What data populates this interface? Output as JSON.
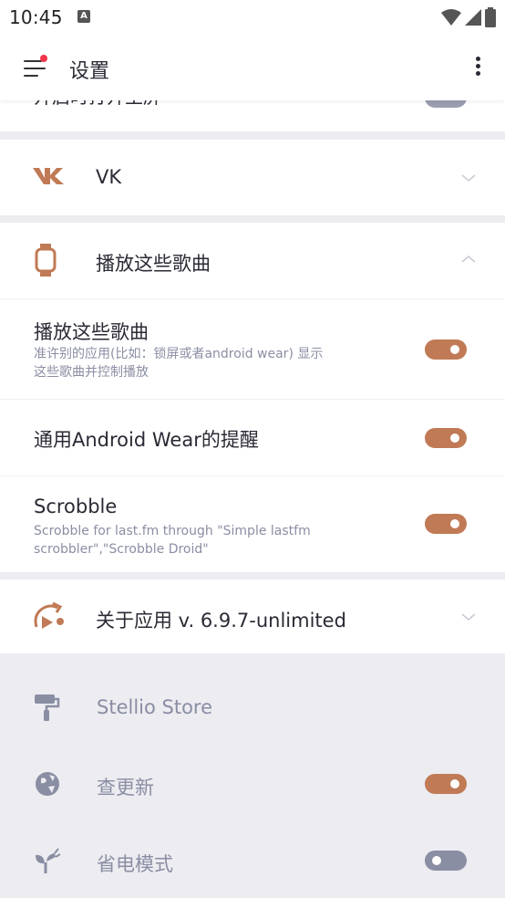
{
  "status_bar": {
    "time": "10:45",
    "notification_icon": "a-letter-icon"
  },
  "app_bar": {
    "title": "设置",
    "menu_icon": "menu-icon",
    "more_icon": "more-vertical-icon"
  },
  "cut_row": {
    "label": "开启时打开主屏"
  },
  "sections": {
    "vk": {
      "label": "VK",
      "icon": "vk-logo-icon",
      "expanded": false
    },
    "play_songs": {
      "label": "播放这些歌曲",
      "icon": "watch-icon",
      "expanded": true
    },
    "about": {
      "label": "关于应用 v. 6.9.7-unlimited",
      "icon": "about-app-icon",
      "expanded": false
    }
  },
  "settings": [
    {
      "title": "播放这些歌曲",
      "subtitle": "准许别的应用(比如：锁屏或者android wear) 显示这些歌曲并控制播放",
      "enabled": true
    },
    {
      "title": "通用Android Wear的提醒",
      "subtitle": "",
      "enabled": true
    },
    {
      "title": "Scrobble",
      "subtitle": "Scrobble for last.fm through \"Simple lastfm scrobbler\",\"Scrobble Droid\"",
      "enabled": true
    }
  ],
  "about_items": [
    {
      "label": "Stellio Store",
      "icon": "paint-roller-icon"
    },
    {
      "label": "查更新",
      "icon": "globe-update-icon",
      "enabled": true
    },
    {
      "label": "省电模式",
      "icon": "eco-plug-icon",
      "enabled": false
    }
  ],
  "colors": {
    "accent": "#c07a55",
    "toggle_off": "#8a8ea3",
    "background_grey": "#ececf1"
  }
}
